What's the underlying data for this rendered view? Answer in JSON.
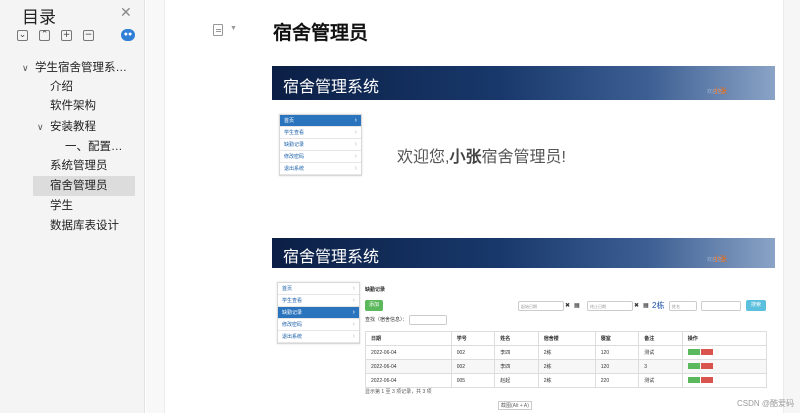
{
  "toc": {
    "title": "目录",
    "items": [
      {
        "label": "学生宿舍管理系…",
        "caret": "∨"
      },
      {
        "label": "介绍"
      },
      {
        "label": "软件架构"
      },
      {
        "label": "安装教程",
        "caret": "∨"
      },
      {
        "label": "一、配置…"
      },
      {
        "label": "系统管理员"
      },
      {
        "label": "宿舍管理员",
        "selected": true
      },
      {
        "label": "学生"
      },
      {
        "label": "数据库表设计"
      }
    ]
  },
  "page_title": "宿舍管理员",
  "shot1": {
    "banner": "宿舍管理系统",
    "banner_small": "欢迎您，",
    "banner_name": "小张",
    "menu": [
      "首页",
      "学生查看",
      "缺勤记录",
      "修改密码",
      "退出系统"
    ],
    "welcome_pre": "欢迎您,",
    "welcome_name": "小张",
    "welcome_post": "宿舍管理员!"
  },
  "shot2": {
    "banner": "宿舍管理系统",
    "banner_small": "欢迎您，",
    "banner_name": "小张",
    "menu": [
      "首页",
      "学生查看",
      "缺勤记录",
      "修改密码",
      "退出系统"
    ],
    "panel_title": "缺勤记录",
    "add": "添加",
    "start_ph": "起始日期",
    "end_ph": "终止日期",
    "building": "2栋",
    "name_sel": "姓名",
    "search": "搜索",
    "filter": "查找（宿舍信息）：",
    "columns": [
      "日期",
      "学号",
      "姓名",
      "宿舍楼",
      "寝室",
      "备注",
      "操作"
    ],
    "rows": [
      [
        "2022-06-04",
        "002",
        "李四",
        "2栋",
        "120",
        "测试"
      ],
      [
        "2022-06-04",
        "002",
        "李四",
        "2栋",
        "120",
        "3"
      ],
      [
        "2022-06-04",
        "005",
        "赵起",
        "2栋",
        "220",
        "测试"
      ]
    ],
    "footer": "显示第 1 至 3 项记录，共 3 项"
  },
  "caption": "截图(Alt + A)",
  "watermark": "CSDN @酷爱码"
}
